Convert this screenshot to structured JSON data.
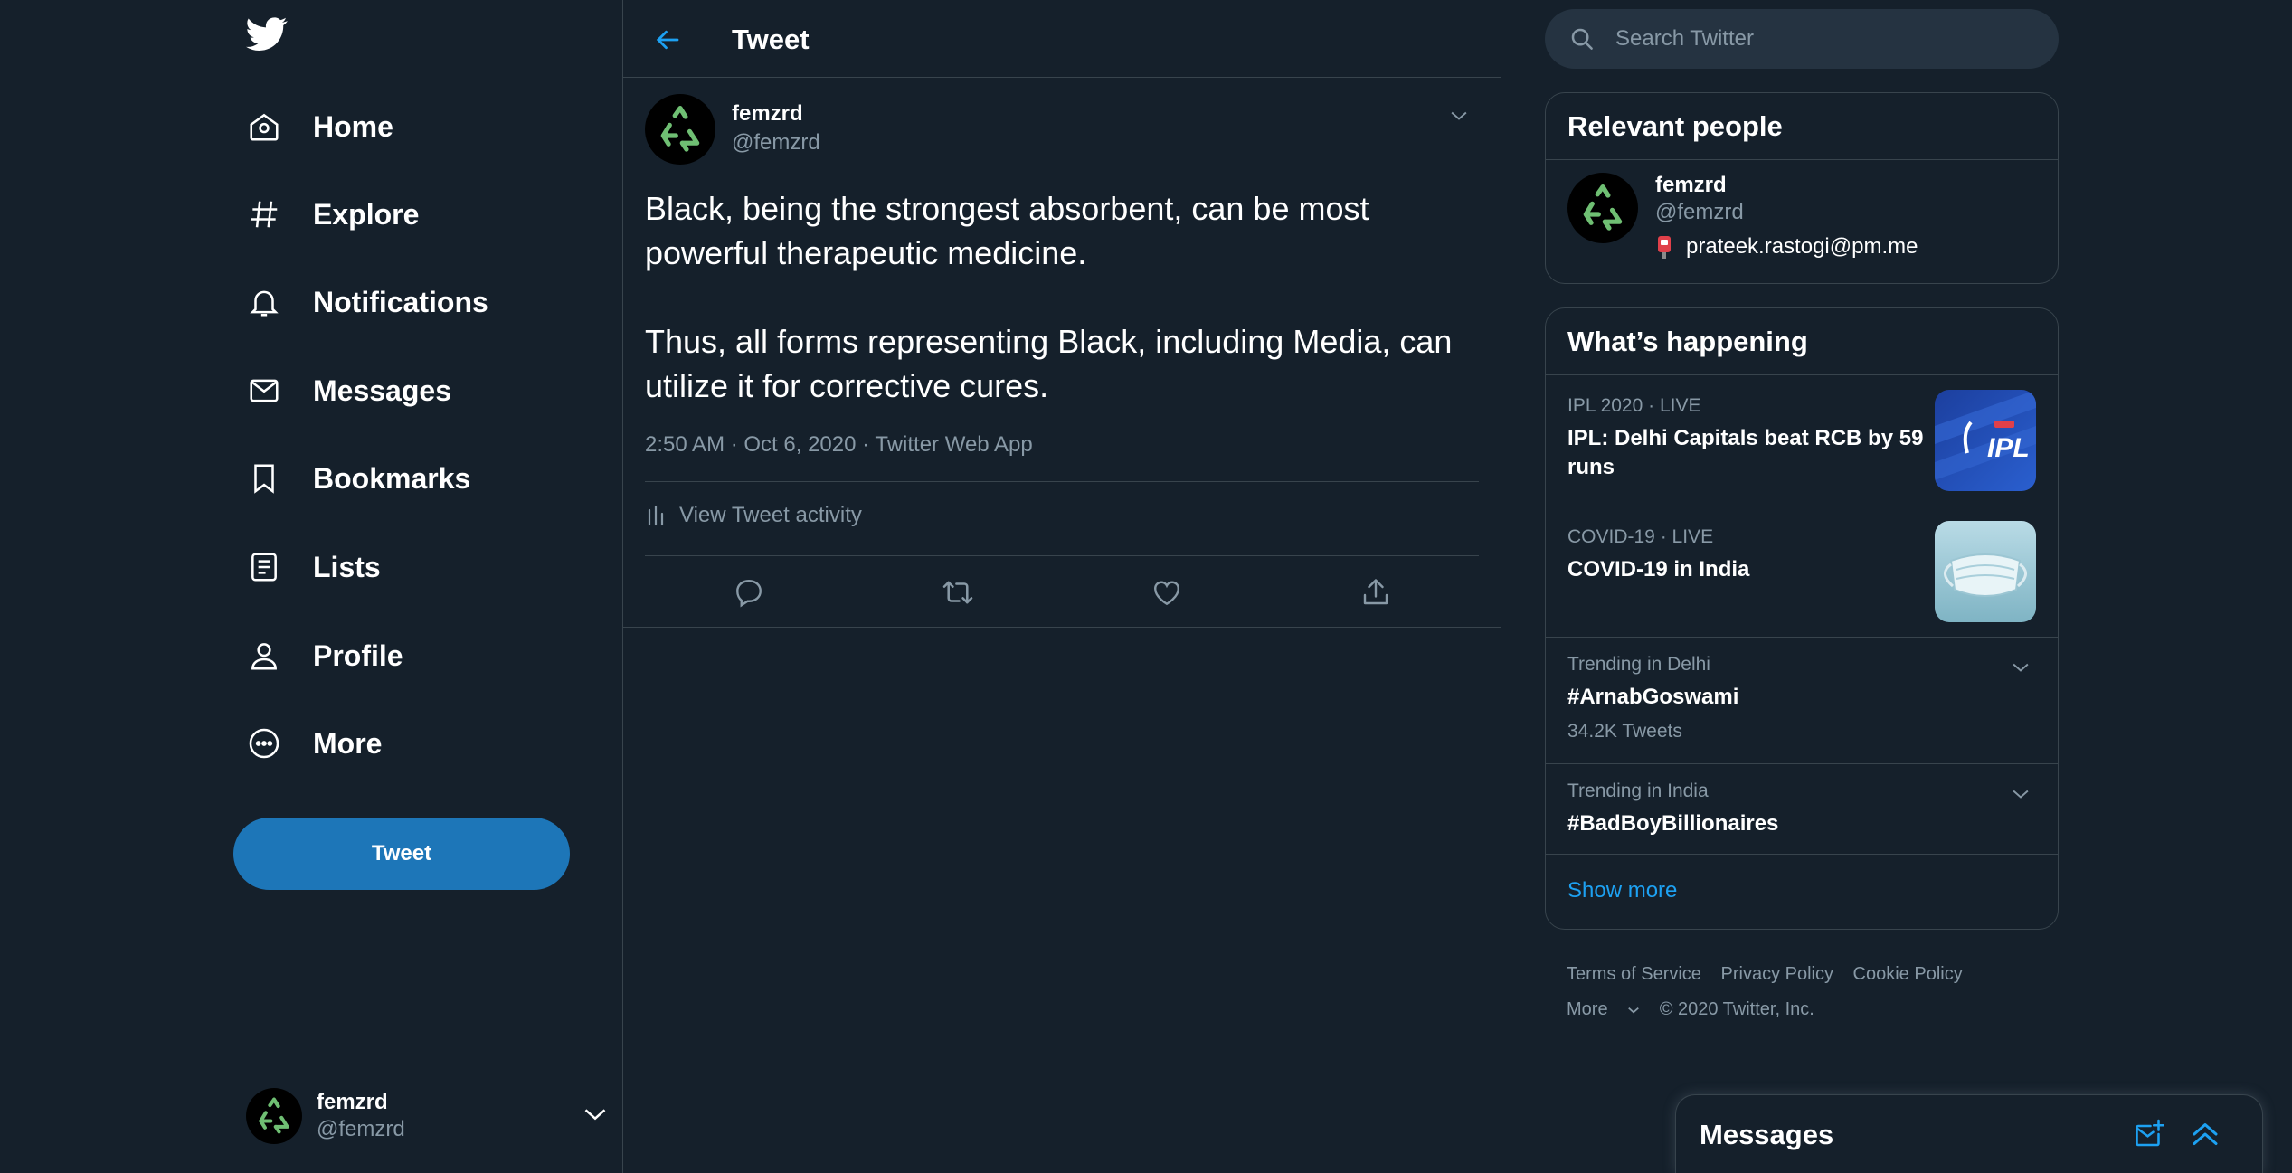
{
  "nav": {
    "items": [
      {
        "label": "Home",
        "icon": "home-icon"
      },
      {
        "label": "Explore",
        "icon": "hashtag-icon"
      },
      {
        "label": "Notifications",
        "icon": "bell-icon"
      },
      {
        "label": "Messages",
        "icon": "envelope-icon"
      },
      {
        "label": "Bookmarks",
        "icon": "bookmark-icon"
      },
      {
        "label": "Lists",
        "icon": "list-icon"
      },
      {
        "label": "Profile",
        "icon": "person-icon"
      },
      {
        "label": "More",
        "icon": "more-circle-icon"
      }
    ],
    "tweet_button": "Tweet",
    "account": {
      "name": "femzrd",
      "handle": "@femzrd"
    }
  },
  "header": {
    "title": "Tweet"
  },
  "tweet": {
    "author_name": "femzrd",
    "author_handle": "@femzrd",
    "paragraphs": [
      "Black, being the strongest absorbent, can be most powerful therapeutic medicine.",
      "Thus, all forms representing Black, including Media, can utilize it for corrective cures."
    ],
    "time": "2:50 AM",
    "date": "Oct 6, 2020",
    "source": "Twitter Web App",
    "meta_sep": " · ",
    "activity_label": "View Tweet activity"
  },
  "sidebar": {
    "search_placeholder": "Search Twitter",
    "relevant_people": {
      "title": "Relevant people",
      "person": {
        "name": "femzrd",
        "handle": "@femzrd",
        "bio": "prateek.rastogi@pm.me"
      }
    },
    "happening": {
      "title": "What’s happening",
      "trends": [
        {
          "category": "IPL 2020",
          "status": "LIVE",
          "title": "IPL: Delhi Capitals beat RCB by 59 runs",
          "thumb_text": "IPL"
        },
        {
          "category": "COVID-19",
          "status": "LIVE",
          "title": "COVID-19 in India"
        },
        {
          "category": "Trending in Delhi",
          "title": "#ArnabGoswami",
          "count": "34.2K Tweets"
        },
        {
          "category": "Trending in India",
          "title": "#BadBoyBillionaires"
        }
      ],
      "dot": "·",
      "show_more": "Show more"
    },
    "footer": {
      "links": [
        "Terms of Service",
        "Privacy Policy",
        "Cookie Policy"
      ],
      "more": "More",
      "copyright": "© 2020 Twitter, Inc."
    }
  },
  "messages_dock": {
    "title": "Messages"
  },
  "colors": {
    "background": "#15202b",
    "accent": "#1da1f2",
    "button": "#1d76b8",
    "border": "#38444d",
    "muted": "#8899a6",
    "recycle": "#6fbf73"
  }
}
